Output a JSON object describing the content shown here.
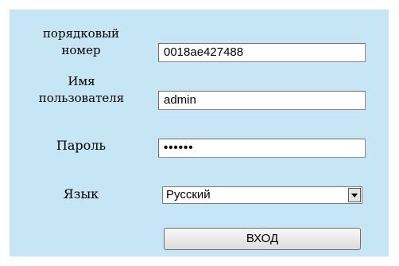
{
  "form": {
    "serial": {
      "label_line1": "порядковый",
      "label_line2": "номер",
      "value": "0018ae427488"
    },
    "username": {
      "label_line1": "Имя",
      "label_line2": "пользователя",
      "value": "admin"
    },
    "password": {
      "label": "Пароль",
      "masked_value": "••••••"
    },
    "language": {
      "label": "Язык",
      "selected": "Русский",
      "icon": "chevron-down-icon"
    },
    "login_button": {
      "label": "ВХОД"
    }
  },
  "colors": {
    "panel_background": "#c6e6f6",
    "page_background": "#ffffff"
  }
}
